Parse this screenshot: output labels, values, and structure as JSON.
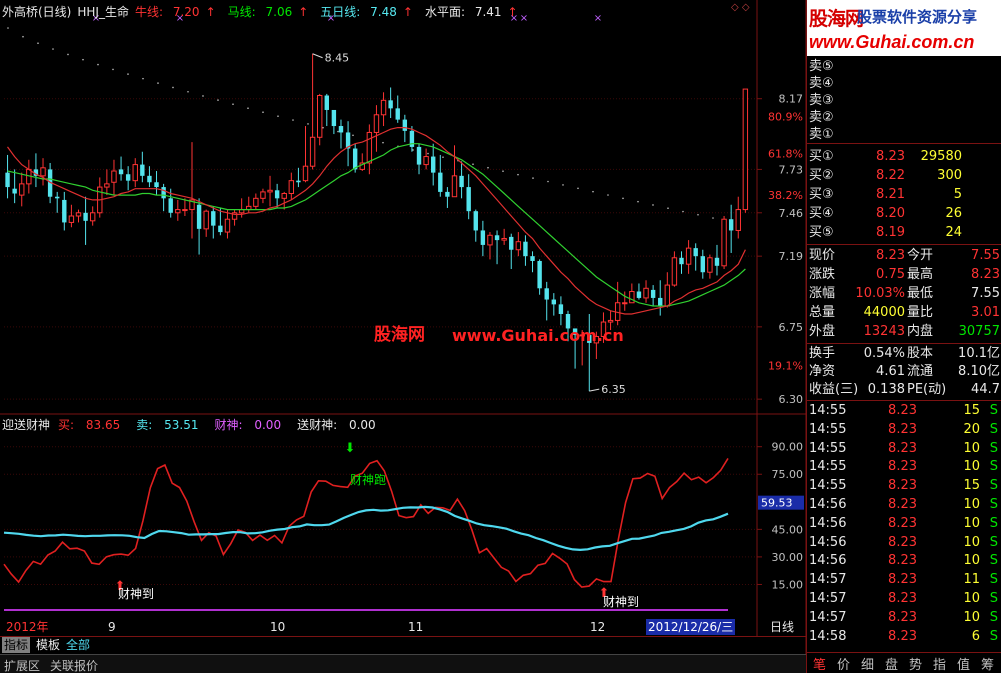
{
  "header": {
    "title": "外高桥(日线)",
    "indicator": "HHJ_生命",
    "niu_label": "牛线:",
    "niu_value": "7.20",
    "ma_label": "马线:",
    "ma_value": "7.06",
    "wu_label": "五日线:",
    "wu_value": "7.48",
    "water_label": "水平面:",
    "water_value": "7.41",
    "up_arrow": "↑",
    "ctrl_icons": "◇ ◇"
  },
  "sub_header": {
    "name": "迎送财神",
    "buy_label": "买:",
    "buy_value": "83.65",
    "sell_label": "卖:",
    "sell_value": "53.51",
    "cs_label": "财神:",
    "cs_value": "0.00",
    "scs_label": "送财神:",
    "scs_value": "0.00"
  },
  "price_axis": [
    "8.17",
    "80.9%",
    "7.73",
    "61.8%",
    "7.46",
    "7.19",
    "38.2%",
    "6.75",
    "19.1%",
    "6.30"
  ],
  "ind_axis": [
    "90.00",
    "75.00",
    "59.53",
    "45.00",
    "30.00",
    "15.00"
  ],
  "annotations": {
    "high": "8.45",
    "low": "6.35",
    "cai_pao": "财神跑",
    "cai_dao_1": "财神到",
    "cai_dao_2": "财神到",
    "down_arrow": "⬇",
    "up_arrow": "⬆"
  },
  "watermark": {
    "left": "股海网",
    "right": "www.Guhai.com.cn"
  },
  "date_axis": {
    "year": "2012年",
    "m9": "9",
    "m10": "10",
    "m11": "11",
    "m12": "12",
    "cursor": "2012/12/26/三",
    "period": "日线"
  },
  "tabs": {
    "t1": "指标",
    "t2": "模板",
    "t3": "全部",
    "b1": "扩展区",
    "b2": "关联报价"
  },
  "chart_data": {
    "type": "line",
    "candles": [
      [
        7.71,
        7.62,
        7.82,
        7.55
      ],
      [
        7.61,
        7.58,
        7.73,
        7.52
      ],
      [
        7.57,
        7.64,
        7.71,
        7.5
      ],
      [
        7.64,
        7.73,
        7.79,
        7.58
      ],
      [
        7.73,
        7.69,
        7.83,
        7.62
      ],
      [
        7.69,
        7.74,
        7.8,
        7.63
      ],
      [
        7.73,
        7.56,
        7.77,
        7.52
      ],
      [
        7.56,
        7.55,
        7.59,
        7.46
      ],
      [
        7.54,
        7.4,
        7.59,
        7.35
      ],
      [
        7.4,
        7.44,
        7.51,
        7.37
      ],
      [
        7.44,
        7.46,
        7.48,
        7.4
      ],
      [
        7.46,
        7.41,
        7.56,
        7.26
      ],
      [
        7.41,
        7.46,
        7.5,
        7.38
      ],
      [
        7.46,
        7.62,
        7.68,
        7.43
      ],
      [
        7.62,
        7.64,
        7.73,
        7.57
      ],
      [
        7.65,
        7.72,
        7.79,
        7.57
      ],
      [
        7.73,
        7.7,
        7.81,
        7.66
      ],
      [
        7.7,
        7.66,
        7.75,
        7.6
      ],
      [
        7.66,
        7.76,
        7.8,
        7.62
      ],
      [
        7.76,
        7.69,
        7.84,
        7.65
      ],
      [
        7.69,
        7.65,
        7.75,
        7.62
      ],
      [
        7.65,
        7.62,
        7.72,
        7.57
      ],
      [
        7.62,
        7.55,
        7.64,
        7.47
      ],
      [
        7.55,
        7.46,
        7.61,
        7.43
      ],
      [
        7.46,
        7.48,
        7.54,
        7.41
      ],
      [
        7.48,
        7.48,
        7.55,
        7.44
      ],
      [
        7.48,
        7.54,
        7.9,
        7.3
      ],
      [
        7.51,
        7.36,
        7.55,
        7.2
      ],
      [
        7.36,
        7.47,
        7.48,
        7.31
      ],
      [
        7.47,
        7.38,
        7.5,
        7.3
      ],
      [
        7.38,
        7.34,
        7.49,
        7.32
      ],
      [
        7.34,
        7.42,
        7.48,
        7.3
      ],
      [
        7.42,
        7.46,
        7.48,
        7.38
      ],
      [
        7.46,
        7.48,
        7.55,
        7.43
      ],
      [
        7.48,
        7.5,
        7.56,
        7.46
      ],
      [
        7.5,
        7.55,
        7.58,
        7.48
      ],
      [
        7.55,
        7.59,
        7.61,
        7.52
      ],
      [
        7.59,
        7.6,
        7.69,
        7.5
      ],
      [
        7.6,
        7.55,
        7.64,
        7.49
      ],
      [
        7.55,
        7.58,
        7.59,
        7.48
      ],
      [
        7.58,
        7.66,
        7.71,
        7.54
      ],
      [
        7.66,
        7.65,
        7.74,
        7.62
      ],
      [
        7.66,
        7.75,
        8.0,
        7.65
      ],
      [
        7.75,
        7.93,
        8.45,
        7.73
      ],
      [
        7.93,
        8.19,
        8.2,
        7.88
      ],
      [
        8.19,
        8.1,
        8.2,
        8.0
      ],
      [
        8.1,
        8.0,
        8.09,
        7.95
      ],
      [
        8.0,
        7.96,
        8.04,
        7.86
      ],
      [
        7.96,
        7.86,
        8.03,
        7.75
      ],
      [
        7.86,
        7.73,
        7.89,
        7.71
      ],
      [
        7.73,
        7.77,
        7.83,
        7.72
      ],
      [
        7.77,
        7.96,
        8.01,
        7.7
      ],
      [
        7.96,
        8.07,
        8.13,
        7.84
      ],
      [
        8.07,
        8.16,
        8.21,
        8.0
      ],
      [
        8.16,
        8.11,
        8.24,
        8.05
      ],
      [
        8.11,
        8.04,
        8.19,
        8.02
      ],
      [
        8.04,
        7.97,
        8.07,
        7.9
      ],
      [
        7.97,
        7.87,
        8.0,
        7.84
      ],
      [
        7.87,
        7.76,
        7.89,
        7.7
      ],
      [
        7.76,
        7.81,
        7.86,
        7.73
      ],
      [
        7.81,
        7.71,
        7.89,
        7.63
      ],
      [
        7.71,
        7.59,
        7.82,
        7.56
      ],
      [
        7.59,
        7.56,
        7.62,
        7.49
      ],
      [
        7.56,
        7.69,
        7.88,
        7.58
      ],
      [
        7.69,
        7.62,
        7.78,
        7.55
      ],
      [
        7.62,
        7.47,
        7.7,
        7.42
      ],
      [
        7.47,
        7.35,
        7.48,
        7.28
      ],
      [
        7.35,
        7.26,
        7.41,
        7.19
      ],
      [
        7.26,
        7.32,
        7.34,
        7.17
      ],
      [
        7.32,
        7.29,
        7.35,
        7.14
      ],
      [
        7.29,
        7.3,
        7.36,
        7.26
      ],
      [
        7.31,
        7.23,
        7.33,
        7.11
      ],
      [
        7.23,
        7.28,
        7.34,
        7.19
      ],
      [
        7.28,
        7.19,
        7.32,
        7.13
      ],
      [
        7.19,
        7.16,
        7.22,
        7.09
      ],
      [
        7.16,
        6.99,
        7.17,
        6.95
      ],
      [
        6.99,
        6.92,
        7.03,
        6.79
      ],
      [
        6.92,
        6.89,
        6.96,
        6.82
      ],
      [
        6.89,
        6.83,
        6.94,
        6.76
      ],
      [
        6.83,
        6.74,
        6.85,
        6.66
      ],
      [
        6.74,
        6.7,
        6.74,
        6.49
      ],
      [
        6.7,
        6.7,
        6.73,
        6.51
      ],
      [
        6.7,
        6.65,
        6.83,
        6.35
      ],
      [
        6.65,
        6.69,
        6.72,
        6.55
      ],
      [
        6.69,
        6.78,
        6.84,
        6.65
      ],
      [
        6.78,
        6.79,
        6.85,
        6.73
      ],
      [
        6.79,
        6.9,
        7.03,
        6.76
      ],
      [
        6.9,
        6.9,
        6.97,
        6.85
      ],
      [
        6.9,
        6.97,
        7.02,
        6.9
      ],
      [
        6.97,
        6.93,
        7.02,
        6.92
      ],
      [
        6.93,
        6.99,
        7.04,
        6.9
      ],
      [
        6.98,
        6.93,
        7.01,
        6.88
      ],
      [
        6.93,
        6.88,
        7.04,
        6.82
      ],
      [
        6.88,
        7.01,
        7.09,
        6.87
      ],
      [
        7.01,
        7.18,
        7.22,
        7.0
      ],
      [
        7.18,
        7.14,
        7.22,
        7.08
      ],
      [
        7.14,
        7.24,
        7.29,
        7.08
      ],
      [
        7.24,
        7.19,
        7.27,
        7.1
      ],
      [
        7.19,
        7.09,
        7.23,
        7.05
      ],
      [
        7.09,
        7.18,
        7.2,
        7.05
      ],
      [
        7.18,
        7.13,
        7.26,
        7.07
      ],
      [
        7.13,
        7.42,
        7.44,
        7.11
      ],
      [
        7.42,
        7.35,
        7.51,
        7.21
      ],
      [
        7.35,
        7.48,
        7.56,
        7.3
      ],
      [
        7.48,
        8.23,
        8.23,
        7.46
      ]
    ],
    "ma_red": [
      7.87,
      7.81,
      7.76,
      7.73,
      7.7,
      7.68,
      7.65,
      7.63,
      7.61,
      7.59,
      7.57,
      7.55,
      7.54,
      7.54,
      7.55,
      7.56,
      7.58,
      7.59,
      7.61,
      7.61,
      7.61,
      7.61,
      7.6,
      7.58,
      7.57,
      7.56,
      7.55,
      7.53,
      7.51,
      7.49,
      7.47,
      7.46,
      7.45,
      7.45,
      7.46,
      7.46,
      7.47,
      7.49,
      7.5,
      7.52,
      7.54,
      7.57,
      7.6,
      7.64,
      7.69,
      7.75,
      7.8,
      7.84,
      7.87,
      7.89,
      7.9,
      7.92,
      7.94,
      7.96,
      7.98,
      7.99,
      7.99,
      7.98,
      7.96,
      7.94,
      7.91,
      7.88,
      7.84,
      7.81,
      7.77,
      7.73,
      7.69,
      7.64,
      7.59,
      7.54,
      7.49,
      7.44,
      7.39,
      7.34,
      7.3,
      7.24,
      7.19,
      7.14,
      7.09,
      7.05,
      7.0,
      6.96,
      6.92,
      6.89,
      6.87,
      6.85,
      6.84,
      6.83,
      6.83,
      6.84,
      6.85,
      6.86,
      6.87,
      6.88,
      6.91,
      6.93,
      6.96,
      6.98,
      6.99,
      7.01,
      7.03,
      7.07,
      7.1,
      7.14,
      7.23
    ],
    "ma_green": [
      7.72,
      7.71,
      7.7,
      7.69,
      7.68,
      7.67,
      7.67,
      7.66,
      7.65,
      7.64,
      7.63,
      7.62,
      7.6,
      7.59,
      7.58,
      7.57,
      7.57,
      7.57,
      7.57,
      7.58,
      7.58,
      7.57,
      7.57,
      7.56,
      7.55,
      7.54,
      7.53,
      7.52,
      7.51,
      7.5,
      7.49,
      7.48,
      7.48,
      7.48,
      7.48,
      7.48,
      7.48,
      7.48,
      7.49,
      7.49,
      7.5,
      7.52,
      7.54,
      7.57,
      7.6,
      7.63,
      7.66,
      7.69,
      7.71,
      7.74,
      7.76,
      7.78,
      7.8,
      7.82,
      7.85,
      7.87,
      7.88,
      7.89,
      7.89,
      7.88,
      7.87,
      7.85,
      7.83,
      7.81,
      7.79,
      7.76,
      7.73,
      7.7,
      7.66,
      7.62,
      7.58,
      7.54,
      7.5,
      7.46,
      7.42,
      7.38,
      7.34,
      7.3,
      7.26,
      7.22,
      7.18,
      7.14,
      7.1,
      7.06,
      7.03,
      7.0,
      6.97,
      6.94,
      6.92,
      6.9,
      6.89,
      6.88,
      6.88,
      6.88,
      6.89,
      6.9,
      6.91,
      6.93,
      6.95,
      6.97,
      6.99,
      7.01,
      7.04,
      7.07,
      7.11
    ],
    "buy_line": [
      26.05,
      20.66,
      16.3,
      22.6,
      27.57,
      26.04,
      31.03,
      33.19,
      38.0,
      34.4,
      34.73,
      33.23,
      26.64,
      25.97,
      30.04,
      31.19,
      31.53,
      30.93,
      34.65,
      49.6,
      67.62,
      78.07,
      80.03,
      70.13,
      67.77,
      60.37,
      49.16,
      38.96,
      43.2,
      41.4,
      31.33,
      37.11,
      44.65,
      43.4,
      38.98,
      41.88,
      39.04,
      41.66,
      37.6,
      46.71,
      50.13,
      52.08,
      65.37,
      71.42,
      71.24,
      68.95,
      68.27,
      67.9,
      74.02,
      75.58,
      80.91,
      82.39,
      76.81,
      65.75,
      52.49,
      51.35,
      51.96,
      58.31,
      53.67,
      56.97,
      56.75,
      55.33,
      61.45,
      55.13,
      44.54,
      32.25,
      34.54,
      29.39,
      24.32,
      22.28,
      16.59,
      19.98,
      20.83,
      25.46,
      26.48,
      31.87,
      29.25,
      26.15,
      17.63,
      13.59,
      14.1,
      18.03,
      16.54,
      16.54,
      39.43,
      59.54,
      72.55,
      72.92,
      75.43,
      73.94,
      61.8,
      67.79,
      71.06,
      75.65,
      72.03,
      73.46,
      70.34,
      73.17,
      77.15,
      83.65
    ],
    "sell_line": [
      43.19,
      42.9,
      42.55,
      41.96,
      41.54,
      41.27,
      41.66,
      41.7,
      42.09,
      41.79,
      41.41,
      41.25,
      41.47,
      41.5,
      41.71,
      41.82,
      41.74,
      41.46,
      40.75,
      40.28,
      42.48,
      44.11,
      43.94,
      43.44,
      42.96,
      42.09,
      42.25,
      42.26,
      42.42,
      42.41,
      43.0,
      43.5,
      43.47,
      42.82,
      42.88,
      43.4,
      44.27,
      44.87,
      45.2,
      46.19,
      46.6,
      47.69,
      47.25,
      47.24,
      47.61,
      49.31,
      51.25,
      52.84,
      54.47,
      55.31,
      55.64,
      55.22,
      55.37,
      56.04,
      56.71,
      56.97,
      56.9,
      57.22,
      56.92,
      55.88,
      54.5,
      52.34,
      50.94,
      49.65,
      48.19,
      47.28,
      46.77,
      46.1,
      45.34,
      43.96,
      42.71,
      41.82,
      40.3,
      39.07,
      37.59,
      36.08,
      34.95,
      34.08,
      33.82,
      34.11,
      35.09,
      35.7,
      36.04,
      37.39,
      38.58,
      39.83,
      39.97,
      40.77,
      41.61,
      43.07,
      43.68,
      44.46,
      45.27,
      46.58,
      48.64,
      49.87,
      50.48,
      51.89,
      53.51
    ],
    "price_range": [
      6.22,
      8.66
    ],
    "ind_range": [
      0,
      98
    ]
  },
  "quote_panel": {
    "ask_labels": [
      "卖⑤",
      "卖④",
      "卖③",
      "卖②",
      "卖①"
    ],
    "bids": [
      {
        "label": "买①",
        "price": "8.23",
        "vol": "29580"
      },
      {
        "label": "买②",
        "price": "8.22",
        "vol": "300"
      },
      {
        "label": "买③",
        "price": "8.21",
        "vol": "5"
      },
      {
        "label": "买④",
        "price": "8.20",
        "vol": "26"
      },
      {
        "label": "买⑤",
        "price": "8.19",
        "vol": "24"
      }
    ],
    "stats": [
      {
        "l1": "现价",
        "v1": "8.23",
        "l2": "今开",
        "v2": "7.55"
      },
      {
        "l1": "涨跌",
        "v1": "0.75",
        "l2": "最高",
        "v2": "8.23"
      },
      {
        "l1": "涨幅",
        "v1": "10.03%",
        "l2": "最低",
        "v2": "7.55"
      },
      {
        "l1": "总量",
        "v1": "44000",
        "l2": "量比",
        "v2": "3.01"
      },
      {
        "l1": "外盘",
        "v1": "13243",
        "l2": "内盘",
        "v2": "30757"
      }
    ],
    "extra": [
      {
        "l1": "换手",
        "v1": "0.54%",
        "l2": "股本",
        "v2": "10.1亿"
      },
      {
        "l1": "净资",
        "v1": "4.61",
        "l2": "流通",
        "v2": "8.10亿"
      },
      {
        "l1": "收益(三)",
        "v1": "0.138",
        "l2": "PE(动)",
        "v2": "44.7"
      }
    ],
    "ticks": [
      {
        "t": "14:55",
        "p": "8.23",
        "v": "15",
        "s": "S"
      },
      {
        "t": "14:55",
        "p": "8.23",
        "v": "20",
        "s": "S"
      },
      {
        "t": "14:55",
        "p": "8.23",
        "v": "10",
        "s": "S"
      },
      {
        "t": "14:55",
        "p": "8.23",
        "v": "10",
        "s": "S"
      },
      {
        "t": "14:55",
        "p": "8.23",
        "v": "15",
        "s": "S"
      },
      {
        "t": "14:56",
        "p": "8.23",
        "v": "10",
        "s": "S"
      },
      {
        "t": "14:56",
        "p": "8.23",
        "v": "10",
        "s": "S"
      },
      {
        "t": "14:56",
        "p": "8.23",
        "v": "10",
        "s": "S"
      },
      {
        "t": "14:56",
        "p": "8.23",
        "v": "10",
        "s": "S"
      },
      {
        "t": "14:57",
        "p": "8.23",
        "v": "11",
        "s": "S"
      },
      {
        "t": "14:57",
        "p": "8.23",
        "v": "10",
        "s": "S"
      },
      {
        "t": "14:57",
        "p": "8.23",
        "v": "10",
        "s": "S"
      },
      {
        "t": "14:58",
        "p": "8.23",
        "v": "6",
        "s": "S"
      }
    ],
    "footer_tabs": [
      "笔",
      "价",
      "细",
      "盘",
      "势",
      "指",
      "值",
      "筹"
    ]
  },
  "banner": {
    "logo_cn": "股海网",
    "tagline": "股票软件资源分享",
    "url": "www.Guhai.com.cn"
  },
  "colors": {
    "up": "#ff3333",
    "down": "#54e4ed",
    "ma_red": "#e03030",
    "ma_green": "#30d030",
    "sell_line": "#4fd8ee",
    "buy_line": "#e02020",
    "axis_red": "#7a1212"
  }
}
